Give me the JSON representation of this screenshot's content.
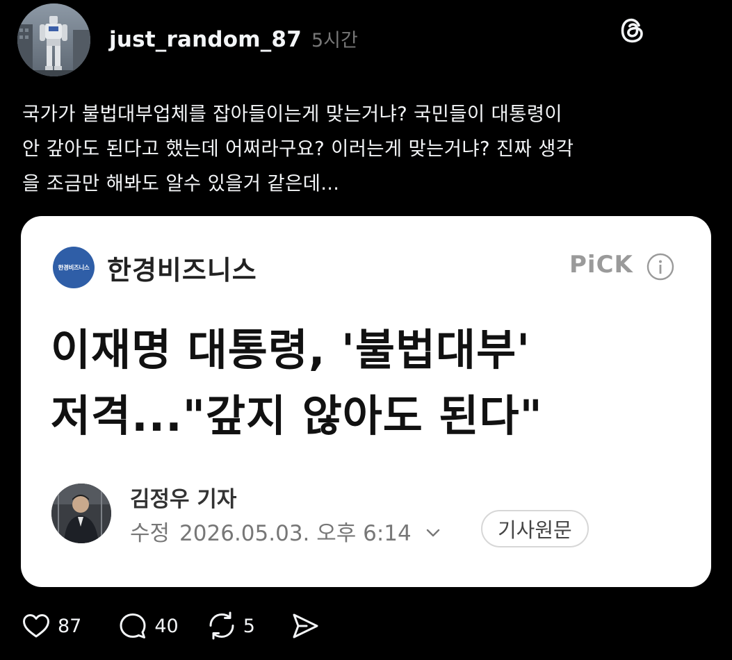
{
  "post": {
    "username": "just_random_87",
    "time": "5시간",
    "text": "국가가 불법대부업체를 잡아들이는게 맞는거냐? 국민들이 대통령이\n안 갚아도 된다고 했는데 어쩌라구요? 이러는게 맞는거냐? 진짜 생각\n을 조금만 해봐도 알수 있을거 같은데...",
    "logo_icon": "threads-logo"
  },
  "card": {
    "press_logo_text": "한경비즈니스",
    "press_name": "한경비즈니스",
    "pick_label": "PiCK",
    "headline": "이재명 대통령, '불법대부'\n저격...\"갚지 않아도 된다\"",
    "reporter": "김정우 기자",
    "edited_label": "수정",
    "datetime": "2026.05.03. 오후 6:14",
    "original_button": "기사원문"
  },
  "actions": {
    "likes": "87",
    "replies": "40",
    "reposts": "5",
    "icons": [
      "heart-icon",
      "comment-icon",
      "repost-icon",
      "share-icon"
    ]
  },
  "colors": {
    "background": "#000000",
    "text": "#f3f5f7",
    "muted": "#777777",
    "press_blue": "#2f5ea7"
  }
}
